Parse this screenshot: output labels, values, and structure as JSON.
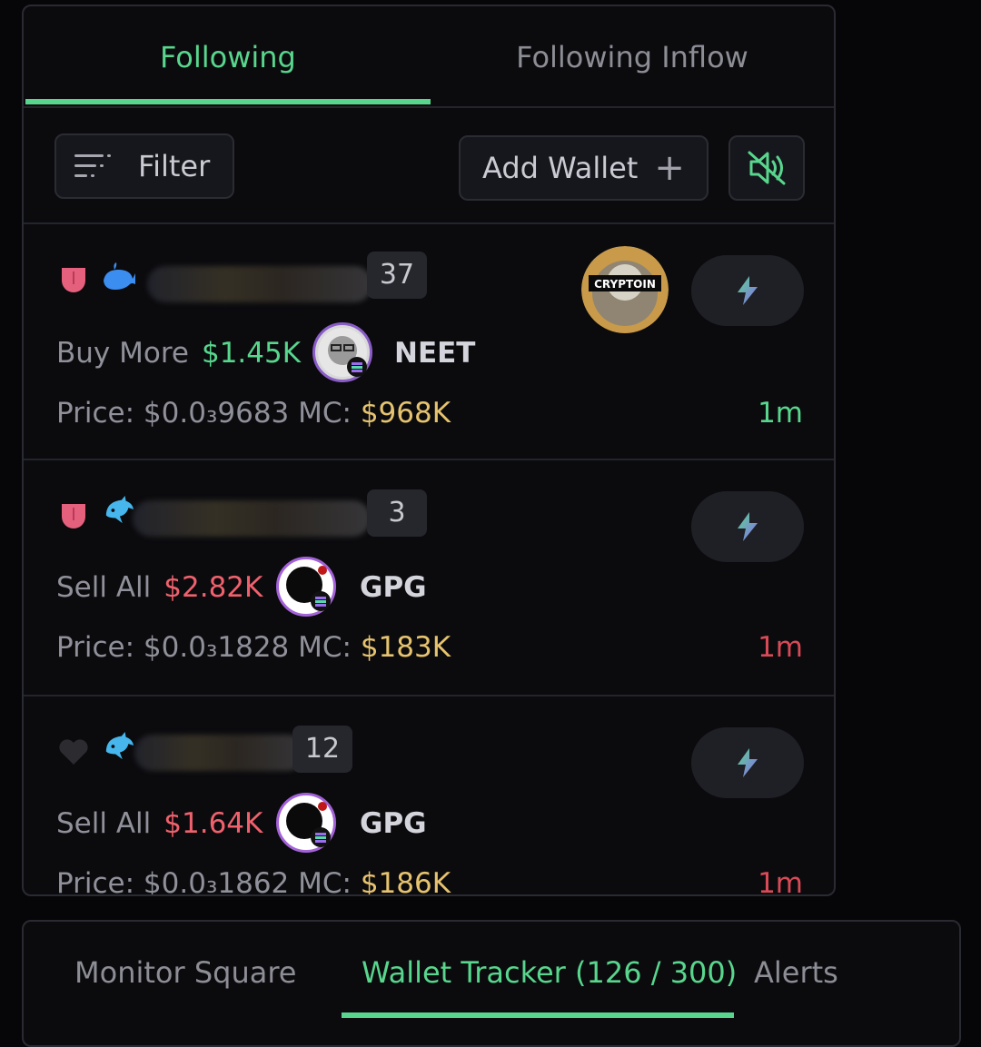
{
  "tabs": [
    {
      "label": "Following",
      "active": true
    },
    {
      "label": "Following Inflow",
      "active": false
    }
  ],
  "toolbar": {
    "filter_label": "Filter",
    "add_wallet_label": "Add Wallet",
    "mute_icon": "speaker-muted-icon"
  },
  "rows": [
    {
      "heart": "pink-heart",
      "animal": "whale-icon",
      "count": "37",
      "action": "Buy More",
      "amount": "$1.45K",
      "side": "buy",
      "token": "NEET",
      "price": "Price: $0.0₃9683",
      "mc_label": "MC:",
      "mc": "$968K",
      "time": "1m",
      "avatar_text": "CRYPTOIN"
    },
    {
      "heart": "pink-heart",
      "animal": "dolphin-icon",
      "count": "3",
      "action": "Sell All",
      "amount": "$2.82K",
      "side": "sell",
      "token": "GPG",
      "price": "Price: $0.0₃1828",
      "mc_label": "MC:",
      "mc": "$183K",
      "time": "1m"
    },
    {
      "heart": "black-heart",
      "animal": "dolphin-icon",
      "count": "12",
      "action": "Sell All",
      "amount": "$1.64K",
      "side": "sell",
      "token": "GPG",
      "price": "Price: $0.0₃1862",
      "mc_label": "MC:",
      "mc": "$186K",
      "time": "1m"
    }
  ],
  "bottom_tabs": [
    {
      "label": "Monitor Square",
      "active": false
    },
    {
      "label": "Wallet Tracker (126 / 300)",
      "active": true
    },
    {
      "label": "Alerts",
      "active": false
    }
  ],
  "colors": {
    "accent_green": "#58d68d",
    "sell_red": "#f0616d",
    "mc_gold": "#e6c36f",
    "background": "#0b0b0e"
  }
}
